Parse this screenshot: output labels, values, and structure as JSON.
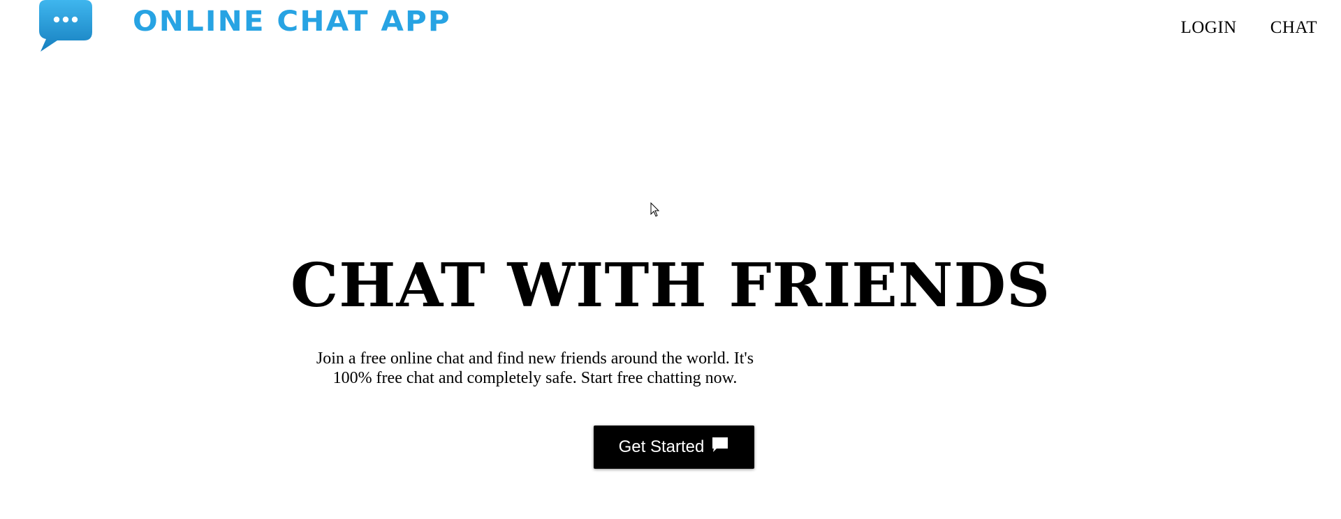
{
  "header": {
    "logo_text": "ONLINE CHAT APP",
    "logo_icon": "chat-bubble-dots-icon",
    "nav": [
      {
        "label": "LOGIN"
      },
      {
        "label": "CHAT"
      }
    ]
  },
  "hero": {
    "title": "CHAT WITH FRIENDS",
    "description": "Join a free online chat and find new friends around the world. It's 100% free chat and completely safe. Start free chatting now.",
    "cta_label": "Get Started",
    "cta_icon": "message-icon"
  },
  "colors": {
    "brand": "#27a3e3",
    "logo_bubble": "#1e9ddc",
    "cta_background": "#000000",
    "cta_text": "#ffffff"
  }
}
